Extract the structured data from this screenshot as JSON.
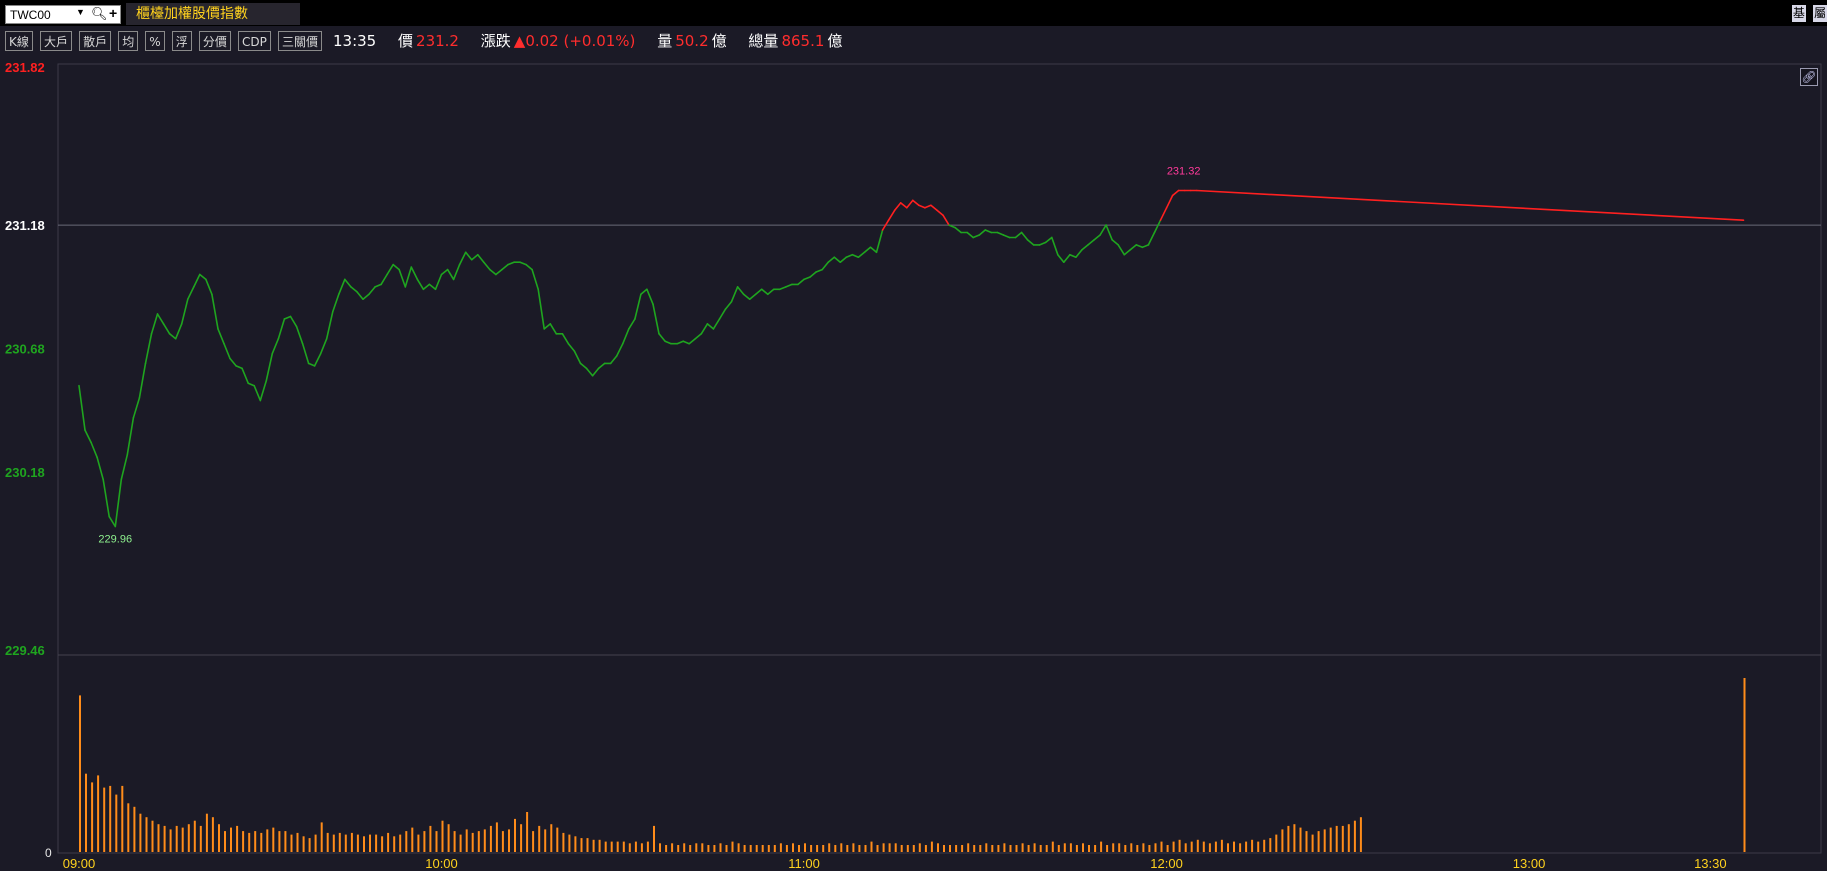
{
  "header": {
    "symbol": "TWC00",
    "index_name": "櫃檯加權股價指數",
    "right_buttons": [
      "基",
      "屬"
    ]
  },
  "toolbar": {
    "buttons": [
      "K線",
      "大戶",
      "散戶",
      "均",
      "%",
      "浮",
      "分價",
      "CDP",
      "三關價"
    ]
  },
  "quote": {
    "time": "13:35",
    "price_label": "價",
    "price": "231.2",
    "change_label": "漲跌",
    "change": "▲0.02 (+0.01%)",
    "volume_label": "量",
    "volume": "50.2",
    "volume_unit": "億",
    "total_label": "總量",
    "total": "865.1",
    "total_unit": "億"
  },
  "colors": {
    "up": "#ff2020",
    "down": "#1fa51f",
    "volume": "#ff8c1a",
    "reference": "#ffffff",
    "background": "#1b1a26"
  },
  "icons": {
    "link": "link-icon",
    "search": "search-icon",
    "add": "plus-icon",
    "dropdown": "caret-down-icon"
  },
  "chart_data": {
    "type": "line",
    "x_type": "time",
    "x_tick_labels": [
      "09:00",
      "10:00",
      "11:00",
      "12:00",
      "13:00",
      "13:30"
    ],
    "x_range": [
      "09:00",
      "13:35"
    ],
    "y_tick_labels": [
      "231.82",
      "231.18",
      "230.68",
      "230.18",
      "229.46"
    ],
    "ylim": [
      229.46,
      231.82
    ],
    "reference_price": 231.18,
    "annotations": {
      "high": "231.32",
      "low": "229.96"
    },
    "volume_axis_label": "0",
    "price_series": [
      [
        "09:00",
        230.53
      ],
      [
        "09:01",
        230.35
      ],
      [
        "09:02",
        230.3
      ],
      [
        "09:03",
        230.24
      ],
      [
        "09:04",
        230.15
      ],
      [
        "09:05",
        230.0
      ],
      [
        "09:06",
        229.96
      ],
      [
        "09:07",
        230.15
      ],
      [
        "09:08",
        230.25
      ],
      [
        "09:09",
        230.4
      ],
      [
        "09:10",
        230.48
      ],
      [
        "09:11",
        230.62
      ],
      [
        "09:12",
        230.74
      ],
      [
        "09:13",
        230.82
      ],
      [
        "09:14",
        230.78
      ],
      [
        "09:15",
        230.74
      ],
      [
        "09:16",
        230.72
      ],
      [
        "09:17",
        230.78
      ],
      [
        "09:18",
        230.88
      ],
      [
        "09:19",
        230.93
      ],
      [
        "09:20",
        230.98
      ],
      [
        "09:21",
        230.96
      ],
      [
        "09:22",
        230.9
      ],
      [
        "09:23",
        230.76
      ],
      [
        "09:24",
        230.7
      ],
      [
        "09:25",
        230.64
      ],
      [
        "09:26",
        230.61
      ],
      [
        "09:27",
        230.6
      ],
      [
        "09:28",
        230.54
      ],
      [
        "09:29",
        230.53
      ],
      [
        "09:30",
        230.47
      ],
      [
        "09:31",
        230.55
      ],
      [
        "09:32",
        230.66
      ],
      [
        "09:33",
        230.72
      ],
      [
        "09:34",
        230.8
      ],
      [
        "09:35",
        230.81
      ],
      [
        "09:36",
        230.77
      ],
      [
        "09:37",
        230.7
      ],
      [
        "09:38",
        230.62
      ],
      [
        "09:39",
        230.61
      ],
      [
        "09:40",
        230.66
      ],
      [
        "09:41",
        230.72
      ],
      [
        "09:42",
        230.83
      ],
      [
        "09:43",
        230.9
      ],
      [
        "09:44",
        230.96
      ],
      [
        "09:45",
        230.93
      ],
      [
        "09:46",
        230.91
      ],
      [
        "09:47",
        230.88
      ],
      [
        "09:48",
        230.9
      ],
      [
        "09:49",
        230.93
      ],
      [
        "09:50",
        230.94
      ],
      [
        "09:51",
        230.98
      ],
      [
        "09:52",
        231.02
      ],
      [
        "09:53",
        231.0
      ],
      [
        "09:54",
        230.93
      ],
      [
        "09:55",
        231.01
      ],
      [
        "09:56",
        230.96
      ],
      [
        "09:57",
        230.92
      ],
      [
        "09:58",
        230.94
      ],
      [
        "09:59",
        230.92
      ],
      [
        "10:00",
        230.98
      ],
      [
        "10:01",
        231.0
      ],
      [
        "10:02",
        230.96
      ],
      [
        "10:03",
        231.02
      ],
      [
        "10:04",
        231.07
      ],
      [
        "10:05",
        231.04
      ],
      [
        "10:06",
        231.06
      ],
      [
        "10:07",
        231.03
      ],
      [
        "10:08",
        231.0
      ],
      [
        "10:09",
        230.98
      ],
      [
        "10:10",
        231.0
      ],
      [
        "10:11",
        231.02
      ],
      [
        "10:12",
        231.03
      ],
      [
        "10:13",
        231.03
      ],
      [
        "10:14",
        231.02
      ],
      [
        "10:15",
        231.0
      ],
      [
        "10:16",
        230.92
      ],
      [
        "10:17",
        230.76
      ],
      [
        "10:18",
        230.78
      ],
      [
        "10:19",
        230.74
      ],
      [
        "10:20",
        230.74
      ],
      [
        "10:21",
        230.7
      ],
      [
        "10:22",
        230.67
      ],
      [
        "10:23",
        230.62
      ],
      [
        "10:24",
        230.6
      ],
      [
        "10:25",
        230.57
      ],
      [
        "10:26",
        230.6
      ],
      [
        "10:27",
        230.62
      ],
      [
        "10:28",
        230.62
      ],
      [
        "10:29",
        230.65
      ],
      [
        "10:30",
        230.7
      ],
      [
        "10:31",
        230.76
      ],
      [
        "10:32",
        230.8
      ],
      [
        "10:33",
        230.9
      ],
      [
        "10:34",
        230.92
      ],
      [
        "10:35",
        230.86
      ],
      [
        "10:36",
        230.74
      ],
      [
        "10:37",
        230.71
      ],
      [
        "10:38",
        230.7
      ],
      [
        "10:39",
        230.7
      ],
      [
        "10:40",
        230.71
      ],
      [
        "10:41",
        230.7
      ],
      [
        "10:42",
        230.72
      ],
      [
        "10:43",
        230.74
      ],
      [
        "10:44",
        230.78
      ],
      [
        "10:45",
        230.76
      ],
      [
        "10:46",
        230.8
      ],
      [
        "10:47",
        230.84
      ],
      [
        "10:48",
        230.87
      ],
      [
        "10:49",
        230.93
      ],
      [
        "10:50",
        230.9
      ],
      [
        "10:51",
        230.88
      ],
      [
        "10:52",
        230.9
      ],
      [
        "10:53",
        230.92
      ],
      [
        "10:54",
        230.9
      ],
      [
        "10:55",
        230.92
      ],
      [
        "10:56",
        230.92
      ],
      [
        "10:57",
        230.93
      ],
      [
        "10:58",
        230.94
      ],
      [
        "10:59",
        230.94
      ],
      [
        "11:00",
        230.96
      ],
      [
        "11:01",
        230.97
      ],
      [
        "11:02",
        230.99
      ],
      [
        "11:03",
        231.0
      ],
      [
        "11:04",
        231.03
      ],
      [
        "11:05",
        231.05
      ],
      [
        "11:06",
        231.03
      ],
      [
        "11:07",
        231.05
      ],
      [
        "11:08",
        231.06
      ],
      [
        "11:09",
        231.05
      ],
      [
        "11:10",
        231.07
      ],
      [
        "11:11",
        231.09
      ],
      [
        "11:12",
        231.07
      ],
      [
        "11:13",
        231.16
      ],
      [
        "11:14",
        231.2
      ],
      [
        "11:15",
        231.24
      ],
      [
        "11:16",
        231.27
      ],
      [
        "11:17",
        231.25
      ],
      [
        "11:18",
        231.28
      ],
      [
        "11:19",
        231.26
      ],
      [
        "11:20",
        231.25
      ],
      [
        "11:21",
        231.26
      ],
      [
        "11:22",
        231.24
      ],
      [
        "11:23",
        231.22
      ],
      [
        "11:24",
        231.18
      ],
      [
        "11:25",
        231.17
      ],
      [
        "11:26",
        231.15
      ],
      [
        "11:27",
        231.15
      ],
      [
        "11:28",
        231.13
      ],
      [
        "11:29",
        231.14
      ],
      [
        "11:30",
        231.16
      ],
      [
        "11:31",
        231.15
      ],
      [
        "11:32",
        231.15
      ],
      [
        "11:33",
        231.14
      ],
      [
        "11:34",
        231.13
      ],
      [
        "11:35",
        231.13
      ],
      [
        "11:36",
        231.15
      ],
      [
        "11:37",
        231.12
      ],
      [
        "11:38",
        231.1
      ],
      [
        "11:39",
        231.1
      ],
      [
        "11:40",
        231.11
      ],
      [
        "11:41",
        231.13
      ],
      [
        "11:42",
        231.06
      ],
      [
        "11:43",
        231.03
      ],
      [
        "11:44",
        231.06
      ],
      [
        "11:45",
        231.05
      ],
      [
        "11:46",
        231.08
      ],
      [
        "11:47",
        231.1
      ],
      [
        "11:48",
        231.12
      ],
      [
        "11:49",
        231.14
      ],
      [
        "11:50",
        231.18
      ],
      [
        "11:51",
        231.12
      ],
      [
        "11:52",
        231.1
      ],
      [
        "11:53",
        231.06
      ],
      [
        "11:54",
        231.08
      ],
      [
        "11:55",
        231.1
      ],
      [
        "11:56",
        231.09
      ],
      [
        "11:57",
        231.1
      ],
      [
        "11:58",
        231.15
      ],
      [
        "11:59",
        231.2
      ],
      [
        "12:00",
        231.25
      ],
      [
        "12:01",
        231.3
      ],
      [
        "12:02",
        231.32
      ],
      [
        "12:03",
        231.32
      ],
      [
        "12:04",
        231.32
      ],
      [
        "12:05",
        231.32
      ],
      [
        "12:06",
        231.2
      ]
    ],
    "volume_series": [
      0.9,
      0.45,
      0.4,
      0.44,
      0.37,
      0.38,
      0.33,
      0.38,
      0.28,
      0.26,
      0.22,
      0.2,
      0.18,
      0.16,
      0.15,
      0.13,
      0.15,
      0.14,
      0.16,
      0.18,
      0.15,
      0.22,
      0.2,
      0.16,
      0.12,
      0.14,
      0.15,
      0.12,
      0.11,
      0.12,
      0.11,
      0.13,
      0.14,
      0.12,
      0.12,
      0.1,
      0.11,
      0.09,
      0.08,
      0.1,
      0.17,
      0.11,
      0.1,
      0.11,
      0.1,
      0.11,
      0.1,
      0.09,
      0.1,
      0.1,
      0.09,
      0.11,
      0.09,
      0.1,
      0.12,
      0.14,
      0.1,
      0.12,
      0.15,
      0.12,
      0.18,
      0.16,
      0.12,
      0.1,
      0.13,
      0.11,
      0.12,
      0.13,
      0.15,
      0.17,
      0.12,
      0.13,
      0.19,
      0.16,
      0.23,
      0.12,
      0.15,
      0.13,
      0.16,
      0.14,
      0.11,
      0.1,
      0.09,
      0.08,
      0.08,
      0.07,
      0.07,
      0.06,
      0.06,
      0.06,
      0.06,
      0.05,
      0.06,
      0.05,
      0.06,
      0.15,
      0.05,
      0.04,
      0.05,
      0.04,
      0.05,
      0.04,
      0.05,
      0.05,
      0.04,
      0.04,
      0.05,
      0.04,
      0.06,
      0.05,
      0.04,
      0.04,
      0.04,
      0.04,
      0.04,
      0.04,
      0.05,
      0.04,
      0.05,
      0.04,
      0.05,
      0.04,
      0.04,
      0.04,
      0.05,
      0.04,
      0.05,
      0.04,
      0.05,
      0.04,
      0.04,
      0.06,
      0.04,
      0.05,
      0.05,
      0.05,
      0.04,
      0.04,
      0.04,
      0.05,
      0.04,
      0.06,
      0.05,
      0.04,
      0.04,
      0.04,
      0.04,
      0.05,
      0.04,
      0.04,
      0.05,
      0.04,
      0.04,
      0.05,
      0.04,
      0.04,
      0.05,
      0.04,
      0.05,
      0.04,
      0.04,
      0.06,
      0.04,
      0.05,
      0.05,
      0.04,
      0.05,
      0.04,
      0.04,
      0.06,
      0.04,
      0.05,
      0.05,
      0.04,
      0.05,
      0.04,
      0.05,
      0.04,
      0.05,
      0.06,
      0.04,
      0.06,
      0.07,
      0.05,
      0.06,
      0.07,
      0.06,
      0.05,
      0.06,
      0.07,
      0.05,
      0.06,
      0.05,
      0.06,
      0.07,
      0.06,
      0.07,
      0.08,
      0.1,
      0.13,
      0.15,
      0.16,
      0.14,
      0.12,
      0.1,
      0.12,
      0.13,
      0.14,
      0.15,
      0.15,
      0.16,
      0.18,
      0.2,
      1.0
    ]
  }
}
